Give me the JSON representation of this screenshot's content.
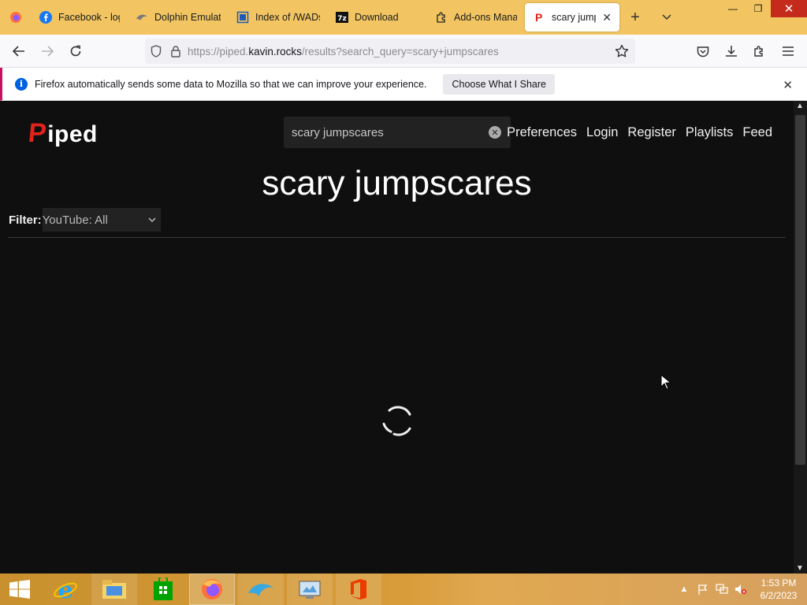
{
  "browser": {
    "tabs": [
      {
        "label": "Facebook - log",
        "icon": "facebook-icon"
      },
      {
        "label": "Dolphin Emulat",
        "icon": "dolphin-icon"
      },
      {
        "label": "Index of /WADs",
        "icon": "index-page-icon"
      },
      {
        "label": "Download",
        "icon": "7zip-icon"
      },
      {
        "label": "Add-ons Mana",
        "icon": "addons-icon"
      },
      {
        "label": "scary jumps",
        "icon": "piped-icon",
        "active": true
      }
    ],
    "url": {
      "prefix": "https://piped.",
      "host": "kavin.rocks",
      "path": "/results?search_query=scary+jumpscares"
    }
  },
  "notification": {
    "text": "Firefox automatically sends some data to Mozilla so that we can improve your experience.",
    "button": "Choose What I Share"
  },
  "site": {
    "logo_first": "P",
    "logo_rest": "iped",
    "search_value": "scary jumpscares",
    "nav": [
      "Preferences",
      "Login",
      "Register",
      "Playlists",
      "Feed"
    ],
    "title": "scary jumpscares",
    "filter_label": "Filter:",
    "filter_value": "YouTube: All",
    "loading": true
  },
  "taskbar": {
    "items": [
      "internet-explorer-icon",
      "file-explorer-icon",
      "store-icon",
      "firefox-icon",
      "dolphin-icon",
      "control-panel-icon",
      "office-icon"
    ],
    "active": "firefox-icon",
    "time": "1:53 PM",
    "date": "6/2/2023"
  },
  "colors": {
    "tab_strip": "#f2c562",
    "page_bg": "#0f0f0f",
    "logo_red": "#e2231a",
    "close_red": "#c42b1c"
  }
}
